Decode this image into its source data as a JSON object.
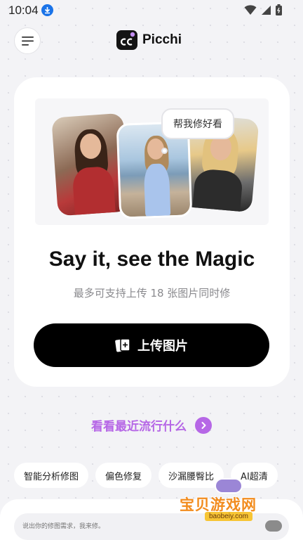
{
  "status_bar": {
    "time": "10:04",
    "icons": [
      "download-icon",
      "wifi-icon",
      "signal-icon",
      "battery-icon"
    ]
  },
  "header": {
    "app_name": "Picchi",
    "menu_icon": "menu-icon"
  },
  "hero": {
    "bubble_text": "帮我修好看",
    "headline": "Say it, see the Magic",
    "subline": "最多可支持上传 18 张图片同时修",
    "upload_label": "上传图片",
    "upload_icon": "upload-photos-icon"
  },
  "trending": {
    "label": "看看最近流行什么",
    "icon": "chevron-right-icon"
  },
  "chips": [
    {
      "label": "智能分析修图"
    },
    {
      "label": "偏色修复"
    },
    {
      "label": "沙漏腰臀比"
    },
    {
      "label": "AI超清"
    }
  ],
  "prompt": {
    "placeholder": "说出你的修图需求，我来修。"
  },
  "watermark": {
    "title": "宝贝游戏网",
    "url": "baobeiy.com"
  },
  "colors": {
    "accent": "#b667e6",
    "button_bg": "#000000",
    "page_bg": "#f3f3f6",
    "status_download": "#1a73e8"
  }
}
